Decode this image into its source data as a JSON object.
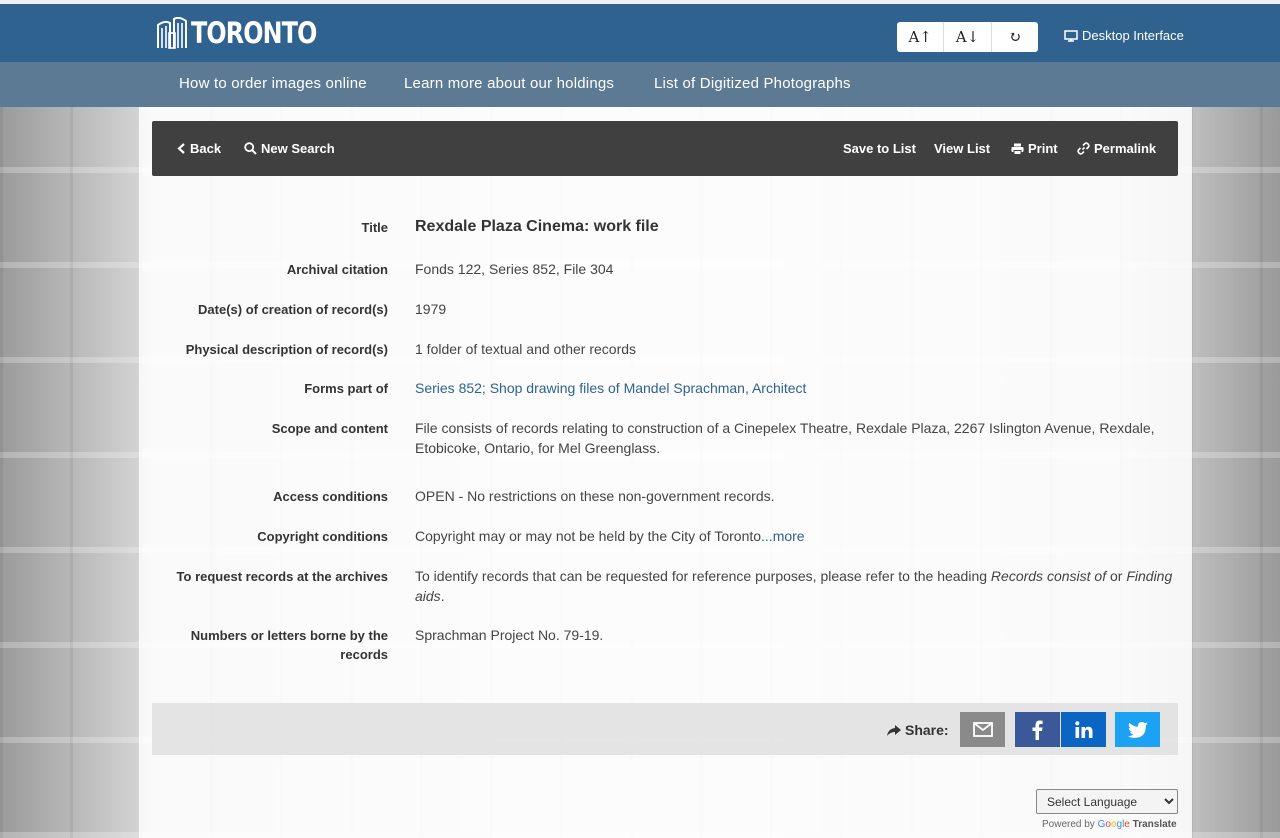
{
  "header": {
    "logo_text": "TORONTO",
    "font_controls": {
      "increase": "A↑",
      "decrease": "A↓",
      "reset": "↻"
    },
    "desktop_link": "Desktop Interface"
  },
  "subnav": {
    "items": [
      "How to order images online",
      "Learn more about our holdings",
      "List of Digitized Photographs"
    ]
  },
  "toolbar": {
    "back": "Back",
    "new_search": "New Search",
    "save_to_list": "Save to List",
    "view_list": "View List",
    "print": "Print",
    "permalink": "Permalink"
  },
  "record": {
    "title": {
      "label": "Title",
      "value": "Rexdale Plaza Cinema: work file"
    },
    "citation": {
      "label": "Archival citation",
      "value": "Fonds 122, Series 852, File 304"
    },
    "dates": {
      "label": "Date(s) of creation of record(s)",
      "value": "1979"
    },
    "physical": {
      "label": "Physical description of record(s)",
      "value": "1 folder of textual and other records"
    },
    "forms_part_of": {
      "label": "Forms part of",
      "value": "Series 852; Shop drawing files of Mandel Sprachman, Architect"
    },
    "scope": {
      "label": "Scope and content",
      "value": "File consists of records relating to construction of a Cinepelex Theatre, Rexdale Plaza, 2267 Islington Avenue, Rexdale, Etobicoke, Ontario, for Mel Greenglass."
    },
    "access": {
      "label": "Access conditions",
      "value": "OPEN - No restrictions on these non-government records."
    },
    "copyright": {
      "label": "Copyright conditions",
      "value": "Copyright may or may not be held by the City of Toronto",
      "more": "...more"
    },
    "request": {
      "label": "To request records at the archives",
      "value_pre": "To identify records that can be requested for reference purposes, please refer to the heading ",
      "em1": "Records consist of",
      "mid": " or ",
      "em2": "Finding aids",
      "post": "."
    },
    "numbers": {
      "label": "Numbers or letters borne by the records",
      "value": "Sprachman Project No. 79-19."
    }
  },
  "share": {
    "label": "Share:",
    "buttons": [
      {
        "name": "email",
        "color": "#8a8a8a"
      },
      {
        "name": "facebook",
        "color": "#3b5998"
      },
      {
        "name": "linkedin",
        "color": "#0a66c2"
      },
      {
        "name": "twitter",
        "color": "#1da1f2"
      }
    ]
  },
  "translate": {
    "select_label": "Select Language",
    "powered_by": "Powered by",
    "google": "Google",
    "translate": "Translate"
  }
}
